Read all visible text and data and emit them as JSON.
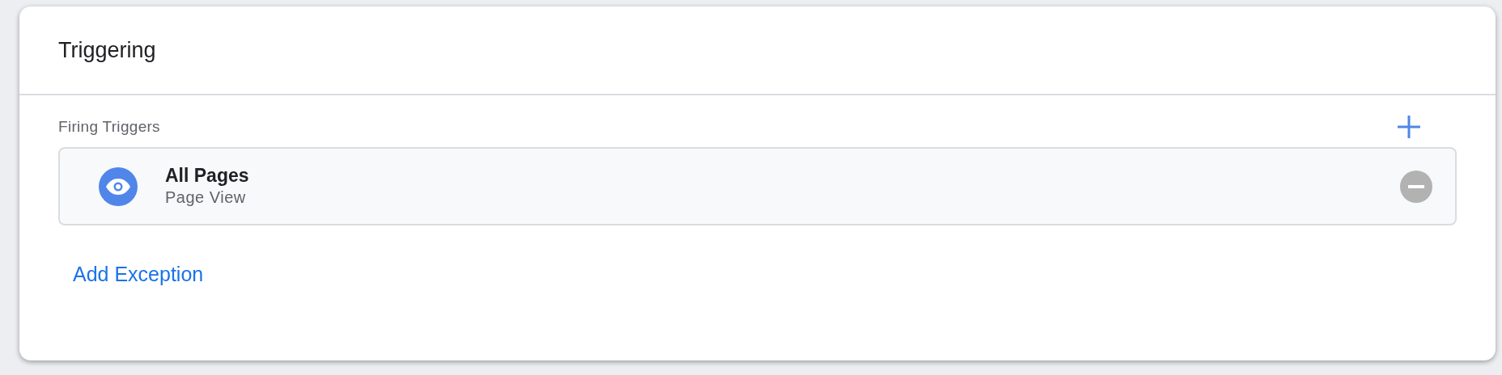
{
  "card": {
    "title": "Triggering"
  },
  "firing_triggers": {
    "label": "Firing Triggers",
    "items": [
      {
        "name": "All Pages",
        "type": "Page View"
      }
    ]
  },
  "add_exception": "Add Exception"
}
